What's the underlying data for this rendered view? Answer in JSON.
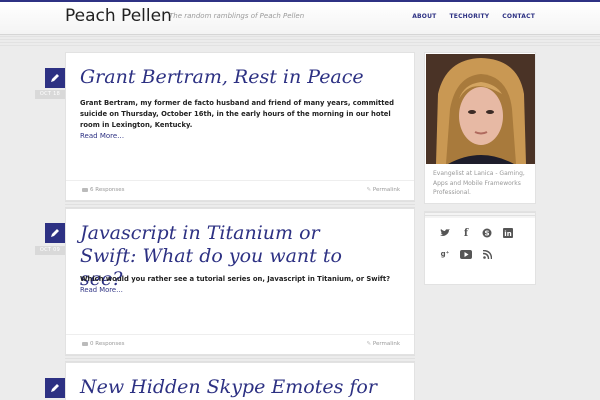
{
  "site": {
    "title": "Peach Pellen",
    "tagline": "The random ramblings of Peach Pellen"
  },
  "nav": [
    {
      "label": "ABOUT"
    },
    {
      "label": "TECHORITY"
    },
    {
      "label": "CONTACT"
    }
  ],
  "posts": [
    {
      "date": "OCT 18",
      "title": "Grant Bertram, Rest in Peace",
      "excerpt": "Grant Bertram, my former de facto husband and friend of many years, committed suicide on Thursday, October 16th, in the early hours of the morning in our hotel room in Lexington, Kentucky.",
      "read_more": "Read More…",
      "comments": "6 Responses",
      "permalink": "Permalink"
    },
    {
      "date": "OCT 09",
      "title": "Javascript in Titanium or Swift: What do you want to see?",
      "excerpt": "Which would you rather see a tutorial series on, Javascript in Titanium, or Swift?",
      "read_more": "Read More…",
      "comments": "0 Responses",
      "permalink": "Permalink"
    },
    {
      "title": "New Hidden Skype Emotes for"
    }
  ],
  "sidebar": {
    "bio": "Evangelist at Lanica - Gaming, Apps and Mobile Frameworks Professional.",
    "social_icons": [
      "twitter-icon",
      "facebook-icon",
      "skype-icon",
      "linkedin-icon",
      "google-plus-icon",
      "youtube-icon",
      "rss-icon"
    ]
  },
  "colors": {
    "accent": "#2d3183",
    "background": "#ececec"
  }
}
